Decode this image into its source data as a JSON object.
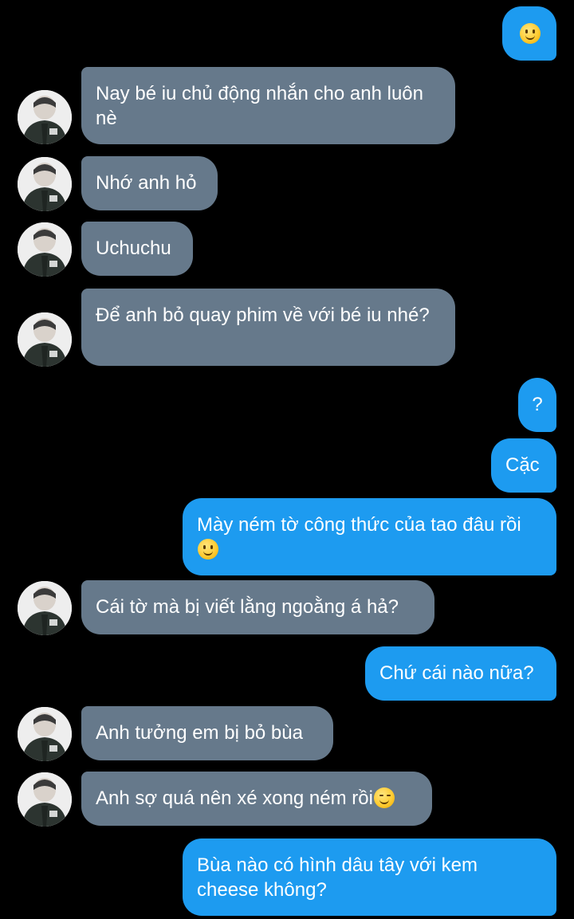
{
  "conversation": {
    "messages": [
      {
        "id": "m1",
        "direction": "outgoing",
        "text": "",
        "emoji": "slight-smile"
      },
      {
        "id": "m2",
        "direction": "incoming",
        "text": "Nay bé iu chủ động nhắn cho anh luôn nè"
      },
      {
        "id": "m3",
        "direction": "incoming",
        "text": "Nhớ anh hỏ"
      },
      {
        "id": "m4",
        "direction": "incoming",
        "text": "Uchuchu"
      },
      {
        "id": "m5",
        "direction": "incoming",
        "text": "Để anh bỏ quay phim về với bé iu nhé?"
      },
      {
        "id": "m6",
        "direction": "outgoing",
        "text": "?"
      },
      {
        "id": "m7",
        "direction": "outgoing",
        "text": "Cặc"
      },
      {
        "id": "m8",
        "direction": "outgoing",
        "text": "Mày ném tờ công thức của tao đâu rồi",
        "emoji": "slight-smile"
      },
      {
        "id": "m9",
        "direction": "incoming",
        "text": "Cái tờ mà bị viết lằng ngoằng á hả?"
      },
      {
        "id": "m10",
        "direction": "outgoing",
        "text": "Chứ cái nào nữa?"
      },
      {
        "id": "m11",
        "direction": "incoming",
        "text": "Anh tưởng em bị bỏ bùa"
      },
      {
        "id": "m12",
        "direction": "incoming",
        "text": "Anh sợ quá nên xé xong ném rồi",
        "emoji": "relieved-blush"
      },
      {
        "id": "m13",
        "direction": "outgoing",
        "text": "Bùa nào có hình dâu tây với kem cheese không?"
      }
    ]
  },
  "colors": {
    "background": "#000000",
    "incoming_bubble": "#66798b",
    "outgoing_bubble": "#1d9bf0",
    "text": "#ffffff"
  },
  "icons": {
    "emoji_smile": "slightly-smiling-face-icon",
    "emoji_blush": "smiling-face-blush-icon",
    "avatar": "contact-avatar"
  }
}
